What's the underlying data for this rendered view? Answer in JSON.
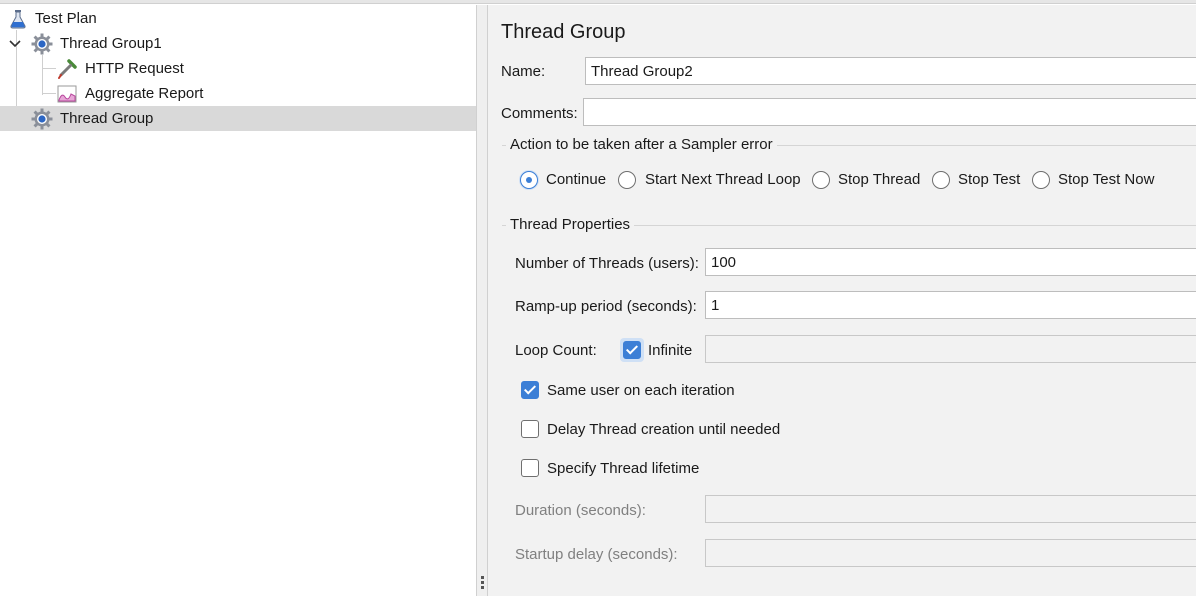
{
  "tree": {
    "items": [
      {
        "label": "Test Plan",
        "icon": "flask-icon"
      },
      {
        "label": "Thread Group1",
        "icon": "gear-icon",
        "expanded": true
      },
      {
        "label": "HTTP Request",
        "icon": "pipette-icon"
      },
      {
        "label": "Aggregate Report",
        "icon": "graph-report-icon"
      },
      {
        "label": "Thread Group",
        "icon": "gear-icon",
        "selected": true
      }
    ]
  },
  "panel": {
    "title": "Thread Group",
    "name_label": "Name:",
    "name_value": "Thread Group2",
    "comments_label": "Comments:",
    "comments_value": "",
    "sampler_error": {
      "title": "Action to be taken after a Sampler error",
      "options": [
        {
          "label": "Continue",
          "checked": true
        },
        {
          "label": "Start Next Thread Loop",
          "checked": false
        },
        {
          "label": "Stop Thread",
          "checked": false
        },
        {
          "label": "Stop Test",
          "checked": false
        },
        {
          "label": "Stop Test Now",
          "checked": false
        }
      ]
    },
    "thread_properties": {
      "title": "Thread Properties",
      "threads_label": "Number of Threads (users):",
      "threads_value": "100",
      "rampup_label": "Ramp-up period (seconds):",
      "rampup_value": "1",
      "loop_label": "Loop Count:",
      "infinite_label": "Infinite",
      "infinite_checked": true,
      "loop_value": "",
      "same_user_label": "Same user on each iteration",
      "same_user_checked": true,
      "delay_label": "Delay Thread creation until needed",
      "delay_checked": false,
      "lifetime_label": "Specify Thread lifetime",
      "lifetime_checked": false,
      "duration_label": "Duration (seconds):",
      "duration_value": "",
      "startup_label": "Startup delay (seconds):",
      "startup_value": ""
    }
  },
  "colors": {
    "accent": "#3c7fd6",
    "selection": "#d9d9d9",
    "panel_bg": "#f2f2f2"
  }
}
